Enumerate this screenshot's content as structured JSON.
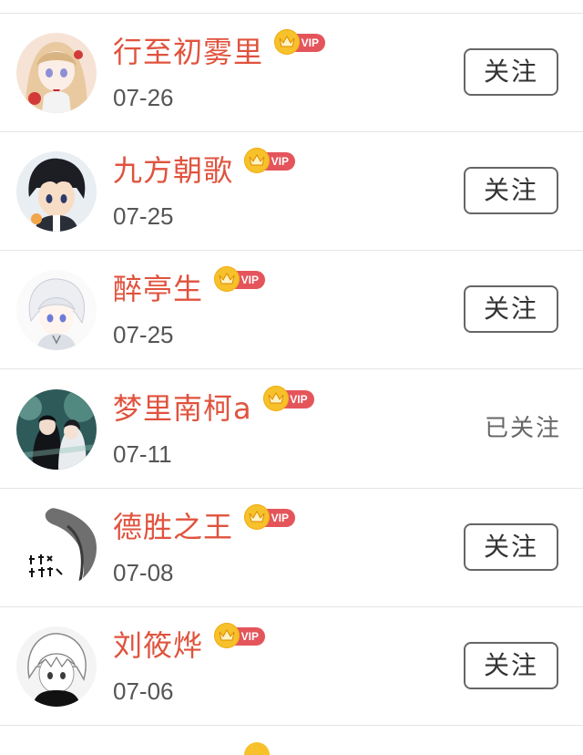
{
  "follow_list": {
    "rows": [
      {
        "name": "行至初雾里",
        "vip": "VIP",
        "date": "07-26",
        "action": "关注",
        "followed": false,
        "avatar": "avatar-anime-girl-red-bow"
      },
      {
        "name": "九方朝歌",
        "vip": "VIP",
        "date": "07-25",
        "action": "关注",
        "followed": false,
        "avatar": "avatar-anime-boy-dark-hair"
      },
      {
        "name": "醉亭生",
        "vip": "VIP",
        "date": "07-25",
        "action": "关注",
        "followed": false,
        "avatar": "avatar-anime-white-hair"
      },
      {
        "name": "梦里南柯a",
        "vip": "VIP",
        "date": "07-11",
        "action": "已关注",
        "followed": true,
        "avatar": "avatar-anime-couple-teal"
      },
      {
        "name": "德胜之王",
        "vip": "VIP",
        "date": "07-08",
        "action": "关注",
        "followed": false,
        "avatar": "avatar-calligraphy-ink"
      },
      {
        "name": "刘筱烨",
        "vip": "VIP",
        "date": "07-06",
        "action": "关注",
        "followed": false,
        "avatar": "avatar-anime-boy-sketch"
      }
    ]
  },
  "colors": {
    "name_text": "#e0533e",
    "vip_pill": "#e4555b",
    "vip_crown": "#f6c12a",
    "date_text": "#555555",
    "button_border": "#666666",
    "divider": "#e4e4e4"
  }
}
